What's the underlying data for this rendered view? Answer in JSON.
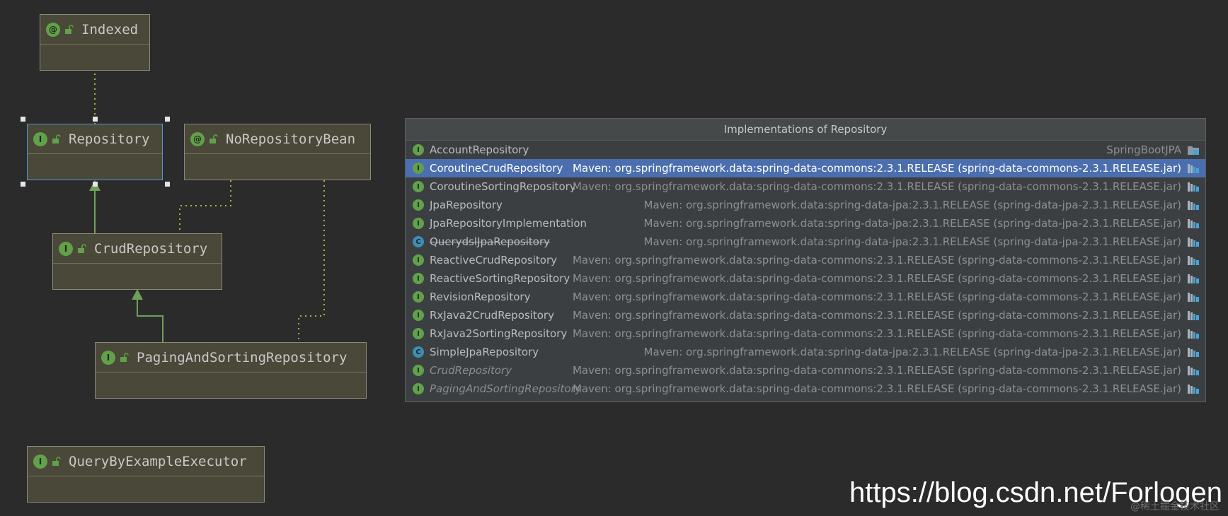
{
  "diagram": {
    "nodes": {
      "indexed": {
        "name": "Indexed",
        "kind": "@"
      },
      "repository": {
        "name": "Repository",
        "kind": "I"
      },
      "norepositorybean": {
        "name": "NoRepositoryBean",
        "kind": "@"
      },
      "crudrepository": {
        "name": "CrudRepository",
        "kind": "I"
      },
      "pagingandsorting": {
        "name": "PagingAndSortingRepository",
        "kind": "I"
      },
      "querybyexample": {
        "name": "QueryByExampleExecutor",
        "kind": "I"
      }
    }
  },
  "popup": {
    "title": "Implementations of Repository",
    "rows": [
      {
        "name": "AccountRepository",
        "kind": "I",
        "location": "SpringBootJPA",
        "style": "normal"
      },
      {
        "name": "CoroutineCrudRepository",
        "kind": "I",
        "location": "Maven: org.springframework.data:spring-data-commons:2.3.1.RELEASE (spring-data-commons-2.3.1.RELEASE.jar)",
        "style": "selected"
      },
      {
        "name": "CoroutineSortingRepository",
        "kind": "I",
        "location": "Maven: org.springframework.data:spring-data-commons:2.3.1.RELEASE (spring-data-commons-2.3.1.RELEASE.jar)",
        "style": "normal"
      },
      {
        "name": "JpaRepository",
        "kind": "I",
        "location": "Maven: org.springframework.data:spring-data-jpa:2.3.1.RELEASE (spring-data-jpa-2.3.1.RELEASE.jar)",
        "style": "normal"
      },
      {
        "name": "JpaRepositoryImplementation",
        "kind": "I",
        "location": "Maven: org.springframework.data:spring-data-jpa:2.3.1.RELEASE (spring-data-jpa-2.3.1.RELEASE.jar)",
        "style": "normal"
      },
      {
        "name": "QuerydslJpaRepository",
        "kind": "C",
        "location": "Maven: org.springframework.data:spring-data-jpa:2.3.1.RELEASE (spring-data-jpa-2.3.1.RELEASE.jar)",
        "style": "struck"
      },
      {
        "name": "ReactiveCrudRepository",
        "kind": "I",
        "location": "Maven: org.springframework.data:spring-data-commons:2.3.1.RELEASE (spring-data-commons-2.3.1.RELEASE.jar)",
        "style": "normal"
      },
      {
        "name": "ReactiveSortingRepository",
        "kind": "I",
        "location": "Maven: org.springframework.data:spring-data-commons:2.3.1.RELEASE (spring-data-commons-2.3.1.RELEASE.jar)",
        "style": "normal"
      },
      {
        "name": "RevisionRepository",
        "kind": "I",
        "location": "Maven: org.springframework.data:spring-data-commons:2.3.1.RELEASE (spring-data-commons-2.3.1.RELEASE.jar)",
        "style": "normal"
      },
      {
        "name": "RxJava2CrudRepository",
        "kind": "I",
        "location": "Maven: org.springframework.data:spring-data-commons:2.3.1.RELEASE (spring-data-commons-2.3.1.RELEASE.jar)",
        "style": "normal"
      },
      {
        "name": "RxJava2SortingRepository",
        "kind": "I",
        "location": "Maven: org.springframework.data:spring-data-commons:2.3.1.RELEASE (spring-data-commons-2.3.1.RELEASE.jar)",
        "style": "normal"
      },
      {
        "name": "SimpleJpaRepository",
        "kind": "C",
        "location": "Maven: org.springframework.data:spring-data-jpa:2.3.1.RELEASE (spring-data-jpa-2.3.1.RELEASE.jar)",
        "style": "normal"
      },
      {
        "name": "CrudRepository",
        "kind": "I",
        "location": "Maven: org.springframework.data:spring-data-commons:2.3.1.RELEASE (spring-data-commons-2.3.1.RELEASE.jar)",
        "style": "italic"
      },
      {
        "name": "PagingAndSortingRepository",
        "kind": "I",
        "location": "Maven: org.springframework.data:spring-data-commons:2.3.1.RELEASE (spring-data-commons-2.3.1.RELEASE.jar)",
        "style": "italic"
      }
    ]
  },
  "colors": {
    "background": "#2b2b2b",
    "node_fill": "#4a4838",
    "selection": "#4b6eaf",
    "interface_icon": "#62a14a",
    "class_icon": "#3d8eb3",
    "inheritance_arrow": "#6fa05a",
    "dependency_dots": "#a8b83a"
  },
  "watermark": {
    "url": "https://blog.csdn.net/Forlogen",
    "sub": "@稀土掘金技术社区"
  }
}
